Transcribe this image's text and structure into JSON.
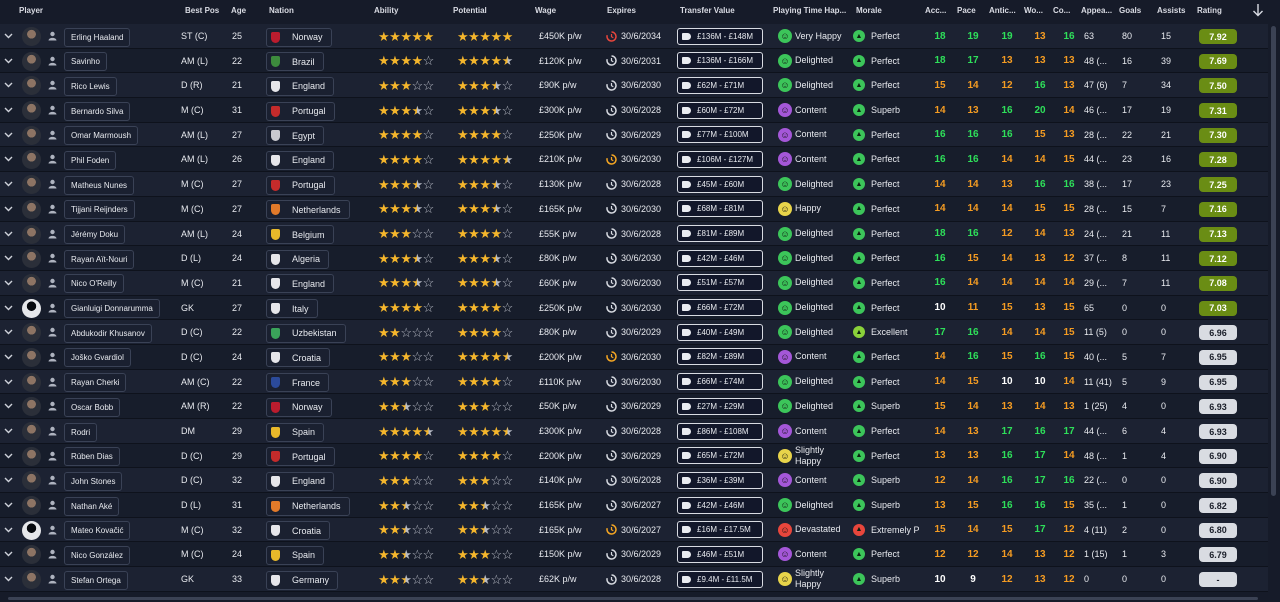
{
  "header": {
    "player": "Player",
    "best_pos": "Best Pos",
    "age": "Age",
    "nation": "Nation",
    "ability": "Ability",
    "potential": "Potential",
    "wage": "Wage",
    "expires": "Expires",
    "transfer_value": "Transfer Value",
    "playing_time": "Playing Time Hap...",
    "morale": "Morale",
    "acc": "Acc...",
    "pace": "Pace",
    "antic": "Antic...",
    "wo": "Wo...",
    "co": "Co...",
    "appearances": "Appea...",
    "goals": "Goals",
    "assists": "Assists",
    "rating": "Rating"
  },
  "colors": {
    "attr_green": "#2ee05a",
    "attr_yellow": "#e8d44a",
    "attr_orange": "#f59c22",
    "attr_white": "#ffffff",
    "rating_high": "#6a8d14",
    "rating_mid": "#d9dce2",
    "expiry_red": "#e8463c",
    "expiry_orange": "#f5a623",
    "expiry_white": "#d6d9e0"
  },
  "players": [
    {
      "name": "Erling Haaland",
      "pos": "ST (C)",
      "age": "25",
      "nation": "Norway",
      "flag": "#ba1c2e",
      "ability": 5,
      "potential": 5,
      "wage": "£450K p/w",
      "expiry_color": "red",
      "expires": "30/6/2034",
      "value": "£136M - £148M",
      "happy": "Very Happy",
      "happy_color": "#3cc55a",
      "morale": "Perfect",
      "morale_color": "#3cc55a",
      "attrs": [
        [
          "18",
          "g"
        ],
        [
          "19",
          "g"
        ],
        [
          "19",
          "g"
        ],
        [
          "13",
          "o"
        ],
        [
          "16",
          "g"
        ]
      ],
      "apps": "63",
      "goals": "80",
      "assists": "15",
      "rating": "7.92",
      "rating_tier": "high"
    },
    {
      "name": "Savinho",
      "pos": "AM (L)",
      "age": "22",
      "nation": "Brazil",
      "flag": "#3d8b3d",
      "ability": 4,
      "potential": 4.5,
      "wage": "£120K p/w",
      "expiry_color": "white",
      "expires": "30/6/2031",
      "value": "£136M - £166M",
      "happy": "Delighted",
      "happy_color": "#3cc55a",
      "morale": "Perfect",
      "morale_color": "#3cc55a",
      "attrs": [
        [
          "18",
          "g"
        ],
        [
          "17",
          "g"
        ],
        [
          "13",
          "o"
        ],
        [
          "13",
          "o"
        ],
        [
          "13",
          "o"
        ]
      ],
      "apps": "48 (...",
      "goals": "16",
      "assists": "39",
      "rating": "7.69",
      "rating_tier": "high"
    },
    {
      "name": "Rico Lewis",
      "pos": "D (R)",
      "age": "21",
      "nation": "England",
      "flag": "#e6e6ea",
      "ability": 3,
      "potential": 3.5,
      "wage": "£90K p/w",
      "expiry_color": "white",
      "expires": "30/6/2030",
      "value": "£62M - £71M",
      "happy": "Delighted",
      "happy_color": "#3cc55a",
      "morale": "Perfect",
      "morale_color": "#3cc55a",
      "attrs": [
        [
          "15",
          "o"
        ],
        [
          "14",
          "o"
        ],
        [
          "12",
          "o"
        ],
        [
          "16",
          "g"
        ],
        [
          "13",
          "o"
        ]
      ],
      "apps": "47 (6)",
      "goals": "7",
      "assists": "34",
      "rating": "7.50",
      "rating_tier": "high"
    },
    {
      "name": "Bernardo Silva",
      "pos": "M (C)",
      "age": "31",
      "nation": "Portugal",
      "flag": "#c42b2b",
      "ability": 3.5,
      "potential": 3.5,
      "wage": "£300K p/w",
      "expiry_color": "white",
      "expires": "30/6/2028",
      "value": "£60M - £72M",
      "happy": "Content",
      "happy_color": "#a457d8",
      "morale": "Superb",
      "morale_color": "#3cc55a",
      "attrs": [
        [
          "14",
          "o"
        ],
        [
          "13",
          "o"
        ],
        [
          "16",
          "g"
        ],
        [
          "20",
          "g"
        ],
        [
          "14",
          "o"
        ]
      ],
      "apps": "46 (...",
      "goals": "17",
      "assists": "19",
      "rating": "7.31",
      "rating_tier": "high"
    },
    {
      "name": "Omar Marmoush",
      "pos": "AM (L)",
      "age": "27",
      "nation": "Egypt",
      "flag": "#c9c9cf",
      "ability": 4,
      "potential": 4,
      "wage": "£250K p/w",
      "expiry_color": "white",
      "expires": "30/6/2029",
      "value": "£77M - £100M",
      "happy": "Content",
      "happy_color": "#a457d8",
      "morale": "Perfect",
      "morale_color": "#3cc55a",
      "attrs": [
        [
          "16",
          "g"
        ],
        [
          "16",
          "g"
        ],
        [
          "16",
          "g"
        ],
        [
          "15",
          "o"
        ],
        [
          "13",
          "o"
        ]
      ],
      "apps": "28 (...",
      "goals": "22",
      "assists": "21",
      "rating": "7.30",
      "rating_tier": "high"
    },
    {
      "name": "Phil Foden",
      "pos": "AM (L)",
      "age": "26",
      "nation": "England",
      "flag": "#e6e6ea",
      "ability": 4,
      "potential": 4.5,
      "wage": "£210K p/w",
      "expiry_color": "orange",
      "expires": "30/6/2030",
      "value": "£106M - £127M",
      "happy": "Content",
      "happy_color": "#a457d8",
      "morale": "Perfect",
      "morale_color": "#3cc55a",
      "attrs": [
        [
          "16",
          "g"
        ],
        [
          "16",
          "g"
        ],
        [
          "14",
          "o"
        ],
        [
          "14",
          "o"
        ],
        [
          "15",
          "o"
        ]
      ],
      "apps": "44 (...",
      "goals": "23",
      "assists": "16",
      "rating": "7.28",
      "rating_tier": "high"
    },
    {
      "name": "Matheus Nunes",
      "pos": "M (C)",
      "age": "27",
      "nation": "Portugal",
      "flag": "#c42b2b",
      "ability": 3.5,
      "potential": 3.5,
      "wage": "£130K p/w",
      "expiry_color": "white",
      "expires": "30/6/2028",
      "value": "£45M - £60M",
      "happy": "Delighted",
      "happy_color": "#3cc55a",
      "morale": "Perfect",
      "morale_color": "#3cc55a",
      "attrs": [
        [
          "14",
          "o"
        ],
        [
          "14",
          "o"
        ],
        [
          "13",
          "o"
        ],
        [
          "16",
          "g"
        ],
        [
          "16",
          "g"
        ]
      ],
      "apps": "38 (...",
      "goals": "17",
      "assists": "23",
      "rating": "7.25",
      "rating_tier": "high"
    },
    {
      "name": "Tijjani Reijnders",
      "pos": "M (C)",
      "age": "27",
      "nation": "Netherlands",
      "flag": "#e27a2a",
      "ability": 3.5,
      "potential": 3.5,
      "wage": "£165K p/w",
      "expiry_color": "white",
      "expires": "30/6/2030",
      "value": "£68M - £81M",
      "happy": "Happy",
      "happy_color": "#e8d44a",
      "morale": "Perfect",
      "morale_color": "#3cc55a",
      "attrs": [
        [
          "14",
          "o"
        ],
        [
          "14",
          "o"
        ],
        [
          "14",
          "o"
        ],
        [
          "15",
          "o"
        ],
        [
          "15",
          "o"
        ]
      ],
      "apps": "28 (...",
      "goals": "15",
      "assists": "7",
      "rating": "7.16",
      "rating_tier": "high"
    },
    {
      "name": "Jérémy Doku",
      "pos": "AM (L)",
      "age": "24",
      "nation": "Belgium",
      "flag": "#e8b82a",
      "ability": 3,
      "potential": 4,
      "wage": "£55K p/w",
      "expiry_color": "white",
      "expires": "30/6/2028",
      "value": "£81M - £89M",
      "happy": "Delighted",
      "happy_color": "#3cc55a",
      "morale": "Perfect",
      "morale_color": "#3cc55a",
      "attrs": [
        [
          "18",
          "g"
        ],
        [
          "16",
          "g"
        ],
        [
          "12",
          "o"
        ],
        [
          "14",
          "o"
        ],
        [
          "13",
          "o"
        ]
      ],
      "apps": "24 (...",
      "goals": "21",
      "assists": "11",
      "rating": "7.13",
      "rating_tier": "high"
    },
    {
      "name": "Rayan Aït-Nouri",
      "pos": "D (L)",
      "age": "24",
      "nation": "Algeria",
      "flag": "#e6e6ea",
      "ability": 3.5,
      "potential": 3.5,
      "wage": "£80K p/w",
      "expiry_color": "white",
      "expires": "30/6/2030",
      "value": "£42M - £46M",
      "happy": "Delighted",
      "happy_color": "#3cc55a",
      "morale": "Perfect",
      "morale_color": "#3cc55a",
      "attrs": [
        [
          "16",
          "g"
        ],
        [
          "15",
          "o"
        ],
        [
          "14",
          "o"
        ],
        [
          "13",
          "o"
        ],
        [
          "12",
          "o"
        ]
      ],
      "apps": "37 (...",
      "goals": "8",
      "assists": "11",
      "rating": "7.12",
      "rating_tier": "high"
    },
    {
      "name": "Nico O'Reilly",
      "pos": "M (C)",
      "age": "21",
      "nation": "England",
      "flag": "#e6e6ea",
      "ability": 3.5,
      "potential": 3.5,
      "wage": "£60K p/w",
      "expiry_color": "white",
      "expires": "30/6/2030",
      "value": "£51M - £57M",
      "happy": "Delighted",
      "happy_color": "#3cc55a",
      "morale": "Perfect",
      "morale_color": "#3cc55a",
      "attrs": [
        [
          "16",
          "g"
        ],
        [
          "14",
          "o"
        ],
        [
          "14",
          "o"
        ],
        [
          "14",
          "o"
        ],
        [
          "14",
          "o"
        ]
      ],
      "apps": "29 (...",
      "goals": "7",
      "assists": "11",
      "rating": "7.08",
      "rating_tier": "high"
    },
    {
      "name": "Gianluigi Donnarumma",
      "pos": "GK",
      "age": "27",
      "nation": "Italy",
      "flag": "#e6e6ea",
      "ability": 4,
      "potential": 4,
      "wage": "£250K p/w",
      "expiry_color": "white",
      "expires": "30/6/2030",
      "value": "£66M - £72M",
      "happy": "Delighted",
      "happy_color": "#3cc55a",
      "morale": "Perfect",
      "morale_color": "#3cc55a",
      "attrs": [
        [
          "10",
          "w"
        ],
        [
          "11",
          "o"
        ],
        [
          "15",
          "o"
        ],
        [
          "13",
          "o"
        ],
        [
          "15",
          "o"
        ]
      ],
      "apps": "65",
      "goals": "0",
      "assists": "0",
      "rating": "7.03",
      "rating_tier": "high",
      "silhouette": true
    },
    {
      "name": "Abdukodir Khusanov",
      "pos": "D (C)",
      "age": "22",
      "nation": "Uzbekistan",
      "flag": "#3aa35a",
      "ability": 2,
      "potential": 4,
      "wage": "£80K p/w",
      "expiry_color": "white",
      "expires": "30/6/2029",
      "value": "£40M - £49M",
      "happy": "Delighted",
      "happy_color": "#3cc55a",
      "morale": "Excellent",
      "morale_color": "#8ad13a",
      "attrs": [
        [
          "17",
          "g"
        ],
        [
          "16",
          "g"
        ],
        [
          "14",
          "o"
        ],
        [
          "14",
          "o"
        ],
        [
          "15",
          "o"
        ]
      ],
      "apps": "11 (5)",
      "goals": "0",
      "assists": "0",
      "rating": "6.96",
      "rating_tier": "mid"
    },
    {
      "name": "Joško Gvardiol",
      "pos": "D (C)",
      "age": "24",
      "nation": "Croatia",
      "flag": "#e6e6ea",
      "ability": 3,
      "potential": 4.5,
      "wage": "£200K p/w",
      "expiry_color": "orange",
      "expires": "30/6/2030",
      "value": "£82M - £89M",
      "happy": "Content",
      "happy_color": "#a457d8",
      "morale": "Perfect",
      "morale_color": "#3cc55a",
      "attrs": [
        [
          "14",
          "o"
        ],
        [
          "16",
          "g"
        ],
        [
          "15",
          "o"
        ],
        [
          "16",
          "g"
        ],
        [
          "15",
          "o"
        ]
      ],
      "apps": "40 (...",
      "goals": "5",
      "assists": "7",
      "rating": "6.95",
      "rating_tier": "mid"
    },
    {
      "name": "Rayan Cherki",
      "pos": "AM (C)",
      "age": "22",
      "nation": "France",
      "flag": "#2b4a9a",
      "ability": 3,
      "potential": 4,
      "wage": "£110K p/w",
      "expiry_color": "white",
      "expires": "30/6/2030",
      "value": "£66M - £74M",
      "happy": "Delighted",
      "happy_color": "#3cc55a",
      "morale": "Perfect",
      "morale_color": "#3cc55a",
      "attrs": [
        [
          "14",
          "o"
        ],
        [
          "15",
          "o"
        ],
        [
          "10",
          "w"
        ],
        [
          "10",
          "w"
        ],
        [
          "14",
          "o"
        ]
      ],
      "apps": "11 (41)",
      "goals": "5",
      "assists": "9",
      "rating": "6.95",
      "rating_tier": "mid"
    },
    {
      "name": "Oscar Bobb",
      "pos": "AM (R)",
      "age": "22",
      "nation": "Norway",
      "flag": "#ba1c2e",
      "ability": 2.5,
      "potential": 3,
      "wage": "£50K p/w",
      "expiry_color": "white",
      "expires": "30/6/2029",
      "value": "£27M - £29M",
      "happy": "Delighted",
      "happy_color": "#3cc55a",
      "morale": "Superb",
      "morale_color": "#3cc55a",
      "attrs": [
        [
          "15",
          "o"
        ],
        [
          "14",
          "o"
        ],
        [
          "13",
          "o"
        ],
        [
          "14",
          "o"
        ],
        [
          "13",
          "o"
        ]
      ],
      "apps": "1 (25)",
      "goals": "4",
      "assists": "0",
      "rating": "6.93",
      "rating_tier": "mid"
    },
    {
      "name": "Rodri",
      "pos": "DM",
      "age": "29",
      "nation": "Spain",
      "flag": "#e8b82a",
      "ability": 4.5,
      "potential": 4.5,
      "wage": "£300K p/w",
      "expiry_color": "white",
      "expires": "30/6/2028",
      "value": "£86M - £108M",
      "happy": "Content",
      "happy_color": "#a457d8",
      "morale": "Perfect",
      "morale_color": "#3cc55a",
      "attrs": [
        [
          "14",
          "o"
        ],
        [
          "13",
          "o"
        ],
        [
          "17",
          "g"
        ],
        [
          "16",
          "g"
        ],
        [
          "17",
          "g"
        ]
      ],
      "apps": "44 (...",
      "goals": "6",
      "assists": "4",
      "rating": "6.93",
      "rating_tier": "mid"
    },
    {
      "name": "Rúben Dias",
      "pos": "D (C)",
      "age": "29",
      "nation": "Portugal",
      "flag": "#c42b2b",
      "ability": 4,
      "potential": 4,
      "wage": "£200K p/w",
      "expiry_color": "white",
      "expires": "30/6/2029",
      "value": "£65M - £72M",
      "happy": "Slightly Happy",
      "happy_color": "#e8d44a",
      "morale": "Perfect",
      "morale_color": "#3cc55a",
      "attrs": [
        [
          "13",
          "o"
        ],
        [
          "13",
          "o"
        ],
        [
          "16",
          "g"
        ],
        [
          "17",
          "g"
        ],
        [
          "14",
          "o"
        ]
      ],
      "apps": "48 (...",
      "goals": "1",
      "assists": "4",
      "rating": "6.90",
      "rating_tier": "mid"
    },
    {
      "name": "John Stones",
      "pos": "D (C)",
      "age": "32",
      "nation": "England",
      "flag": "#e6e6ea",
      "ability": 3,
      "potential": 3,
      "wage": "£140K p/w",
      "expiry_color": "white",
      "expires": "30/6/2028",
      "value": "£36M - £39M",
      "happy": "Content",
      "happy_color": "#a457d8",
      "morale": "Superb",
      "morale_color": "#3cc55a",
      "attrs": [
        [
          "12",
          "o"
        ],
        [
          "14",
          "o"
        ],
        [
          "16",
          "g"
        ],
        [
          "17",
          "g"
        ],
        [
          "16",
          "g"
        ]
      ],
      "apps": "22 (...",
      "goals": "0",
      "assists": "0",
      "rating": "6.90",
      "rating_tier": "mid"
    },
    {
      "name": "Nathan Aké",
      "pos": "D (L)",
      "age": "31",
      "nation": "Netherlands",
      "flag": "#e27a2a",
      "ability": 2.5,
      "potential": 2.5,
      "wage": "£165K p/w",
      "expiry_color": "white",
      "expires": "30/6/2027",
      "value": "£42M - £46M",
      "happy": "Delighted",
      "happy_color": "#3cc55a",
      "morale": "Superb",
      "morale_color": "#3cc55a",
      "attrs": [
        [
          "13",
          "o"
        ],
        [
          "15",
          "o"
        ],
        [
          "16",
          "g"
        ],
        [
          "16",
          "g"
        ],
        [
          "15",
          "o"
        ]
      ],
      "apps": "35 (...",
      "goals": "1",
      "assists": "0",
      "rating": "6.82",
      "rating_tier": "mid"
    },
    {
      "name": "Mateo Kovačić",
      "pos": "M (C)",
      "age": "32",
      "nation": "Croatia",
      "flag": "#e6e6ea",
      "ability": 2.5,
      "potential": 2.5,
      "wage": "£165K p/w",
      "expiry_color": "orange",
      "expires": "30/6/2027",
      "value": "£16M - £17.5M",
      "happy": "Devastated",
      "happy_color": "#e8463c",
      "morale": "Extremely P",
      "morale_color": "#e8463c",
      "attrs": [
        [
          "15",
          "o"
        ],
        [
          "14",
          "o"
        ],
        [
          "15",
          "o"
        ],
        [
          "17",
          "g"
        ],
        [
          "12",
          "o"
        ]
      ],
      "apps": "4 (11)",
      "goals": "2",
      "assists": "0",
      "rating": "6.80",
      "rating_tier": "mid",
      "silhouette": true
    },
    {
      "name": "Nico González",
      "pos": "M (C)",
      "age": "24",
      "nation": "Spain",
      "flag": "#e8b82a",
      "ability": 2.5,
      "potential": 3,
      "wage": "£150K p/w",
      "expiry_color": "white",
      "expires": "30/6/2029",
      "value": "£46M - £51M",
      "happy": "Content",
      "happy_color": "#a457d8",
      "morale": "Perfect",
      "morale_color": "#3cc55a",
      "attrs": [
        [
          "12",
          "o"
        ],
        [
          "12",
          "o"
        ],
        [
          "14",
          "o"
        ],
        [
          "13",
          "o"
        ],
        [
          "12",
          "o"
        ]
      ],
      "apps": "1 (15)",
      "goals": "1",
      "assists": "3",
      "rating": "6.79",
      "rating_tier": "mid"
    },
    {
      "name": "Stefan Ortega",
      "pos": "GK",
      "age": "33",
      "nation": "Germany",
      "flag": "#e6e6ea",
      "ability": 2.5,
      "potential": 2.5,
      "wage": "£62K p/w",
      "expiry_color": "white",
      "expires": "30/6/2028",
      "value": "£9.4M - £11.5M",
      "happy": "Slightly Happy",
      "happy_color": "#e8d44a",
      "morale": "Superb",
      "morale_color": "#3cc55a",
      "attrs": [
        [
          "10",
          "w"
        ],
        [
          "9",
          "w"
        ],
        [
          "12",
          "o"
        ],
        [
          "13",
          "o"
        ],
        [
          "12",
          "o"
        ]
      ],
      "apps": "0",
      "goals": "0",
      "assists": "0",
      "rating": "-",
      "rating_tier": "mid"
    }
  ]
}
